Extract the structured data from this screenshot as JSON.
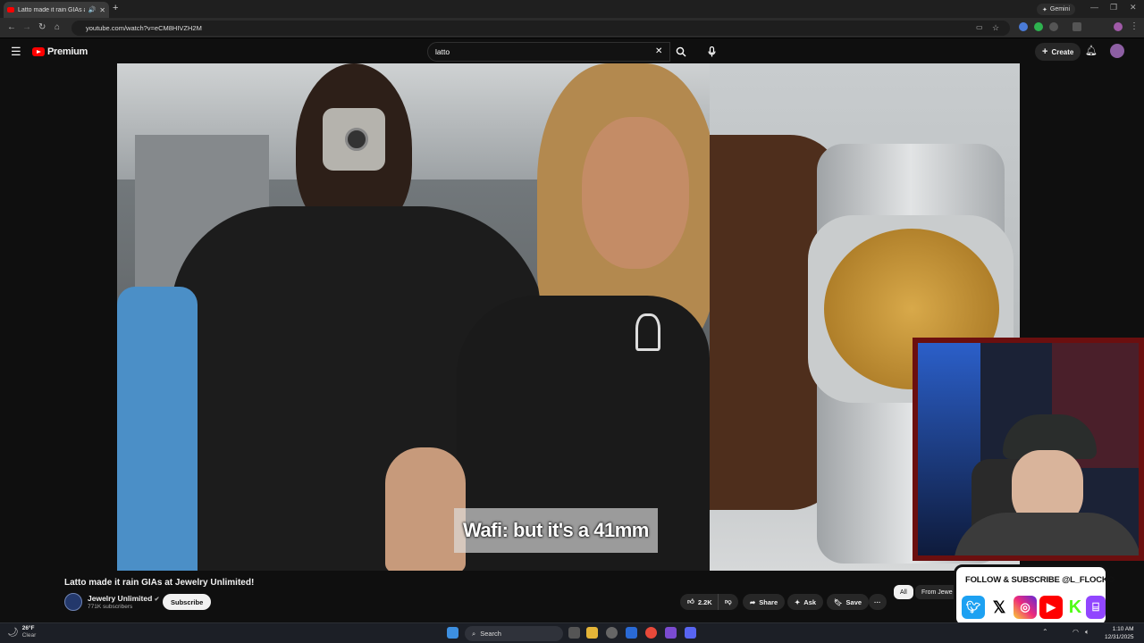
{
  "browser": {
    "tab_title": "Latto made it rain GIAs at J",
    "new_tab": "+",
    "gemini_label": "Gemini",
    "url": "youtube.com/watch?v=eCM8HIVZH2M"
  },
  "youtube": {
    "logo_text": "Premium",
    "search_value": "latto",
    "create_label": "Create"
  },
  "video": {
    "caption": "Wafi: but it's a 41mm",
    "title": "Latto made it rain GIAs at Jewelry Unlimited!",
    "channel_name": "Jewelry Unlimited",
    "subscribers": "771K subscribers",
    "subscribe_label": "Subscribe",
    "likes": "2.2K",
    "share_label": "Share",
    "ask_label": "Ask",
    "save_label": "Save",
    "more_label": "···"
  },
  "chips": {
    "all": "All",
    "from": "From Jewe"
  },
  "overlay": {
    "follow_text": "FOLLOW & SUBSCRIBE @L_FLOCKO"
  },
  "taskbar": {
    "temp": "26°F",
    "condition": "Clear",
    "search_label": "Search",
    "time": "1:10 AM",
    "date": "12/31/2025"
  }
}
